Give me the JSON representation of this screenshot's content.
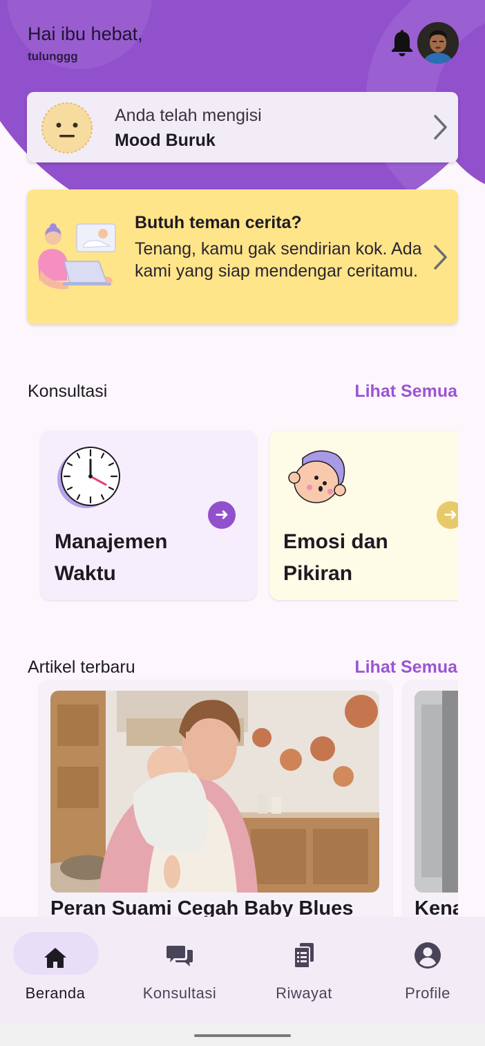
{
  "header": {
    "greeting": "Hai ibu hebat,",
    "username": "tulunggg"
  },
  "mood": {
    "line1": "Anda telah mengisi",
    "line2": "Mood Buruk"
  },
  "story": {
    "title": "Butuh teman cerita?",
    "body": "Tenang, kamu gak sendirian kok. Ada kami yang siap mendengar ceritamu."
  },
  "consultation": {
    "section_title": "Konsultasi",
    "see_all": "Lihat Semua",
    "cards": [
      {
        "title": "Manajemen Waktu",
        "bg": "#f6eefc",
        "accent": "#9150cc"
      },
      {
        "title": "Emosi dan Pikiran",
        "bg": "#fefbe6",
        "accent": "#e8c96a"
      }
    ]
  },
  "articles": {
    "section_title": "Artikel terbaru",
    "see_all": "Lihat Semua",
    "items": [
      {
        "title": "Peran Suami Cegah Baby Blues"
      },
      {
        "title": "Kena"
      }
    ]
  },
  "bottom_nav": [
    {
      "label": "Beranda",
      "icon": "home-icon",
      "active": true
    },
    {
      "label": "Konsultasi",
      "icon": "chat-icon",
      "active": false
    },
    {
      "label": "Riwayat",
      "icon": "history-icon",
      "active": false
    },
    {
      "label": "Profile",
      "icon": "profile-icon",
      "active": false
    }
  ],
  "colors": {
    "brand_purple": "#9150cc",
    "link_purple": "#9a55d2",
    "story_yellow": "#ffe589"
  }
}
